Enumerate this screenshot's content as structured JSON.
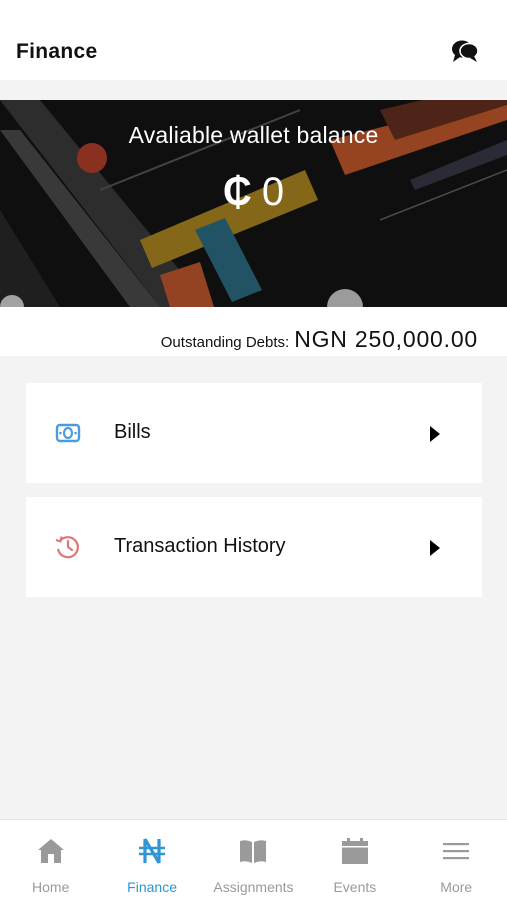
{
  "header": {
    "title": "Finance",
    "chat_icon": "chat-bubbles-icon"
  },
  "wallet": {
    "label": "Avaliable wallet balance",
    "currency_symbol": "₵",
    "amount": "0"
  },
  "debts": {
    "label": "Outstanding Debts:",
    "value": "NGN 250,000.00"
  },
  "menu": [
    {
      "label": "Bills",
      "icon": "money-icon",
      "icon_color": "#4a9be0"
    },
    {
      "label": "Transaction History",
      "icon": "history-icon",
      "icon_color": "#e07575"
    }
  ],
  "tabs": [
    {
      "label": "Home",
      "icon": "home-icon",
      "active": false
    },
    {
      "label": "Finance",
      "icon": "naira-icon",
      "active": true
    },
    {
      "label": "Assignments",
      "icon": "book-icon",
      "active": false
    },
    {
      "label": "Events",
      "icon": "calendar-icon",
      "active": false
    },
    {
      "label": "More",
      "icon": "menu-icon",
      "active": false
    }
  ],
  "colors": {
    "accent": "#2f95d3",
    "inactive": "#9a9a9a",
    "background": "#f3f3f3"
  }
}
